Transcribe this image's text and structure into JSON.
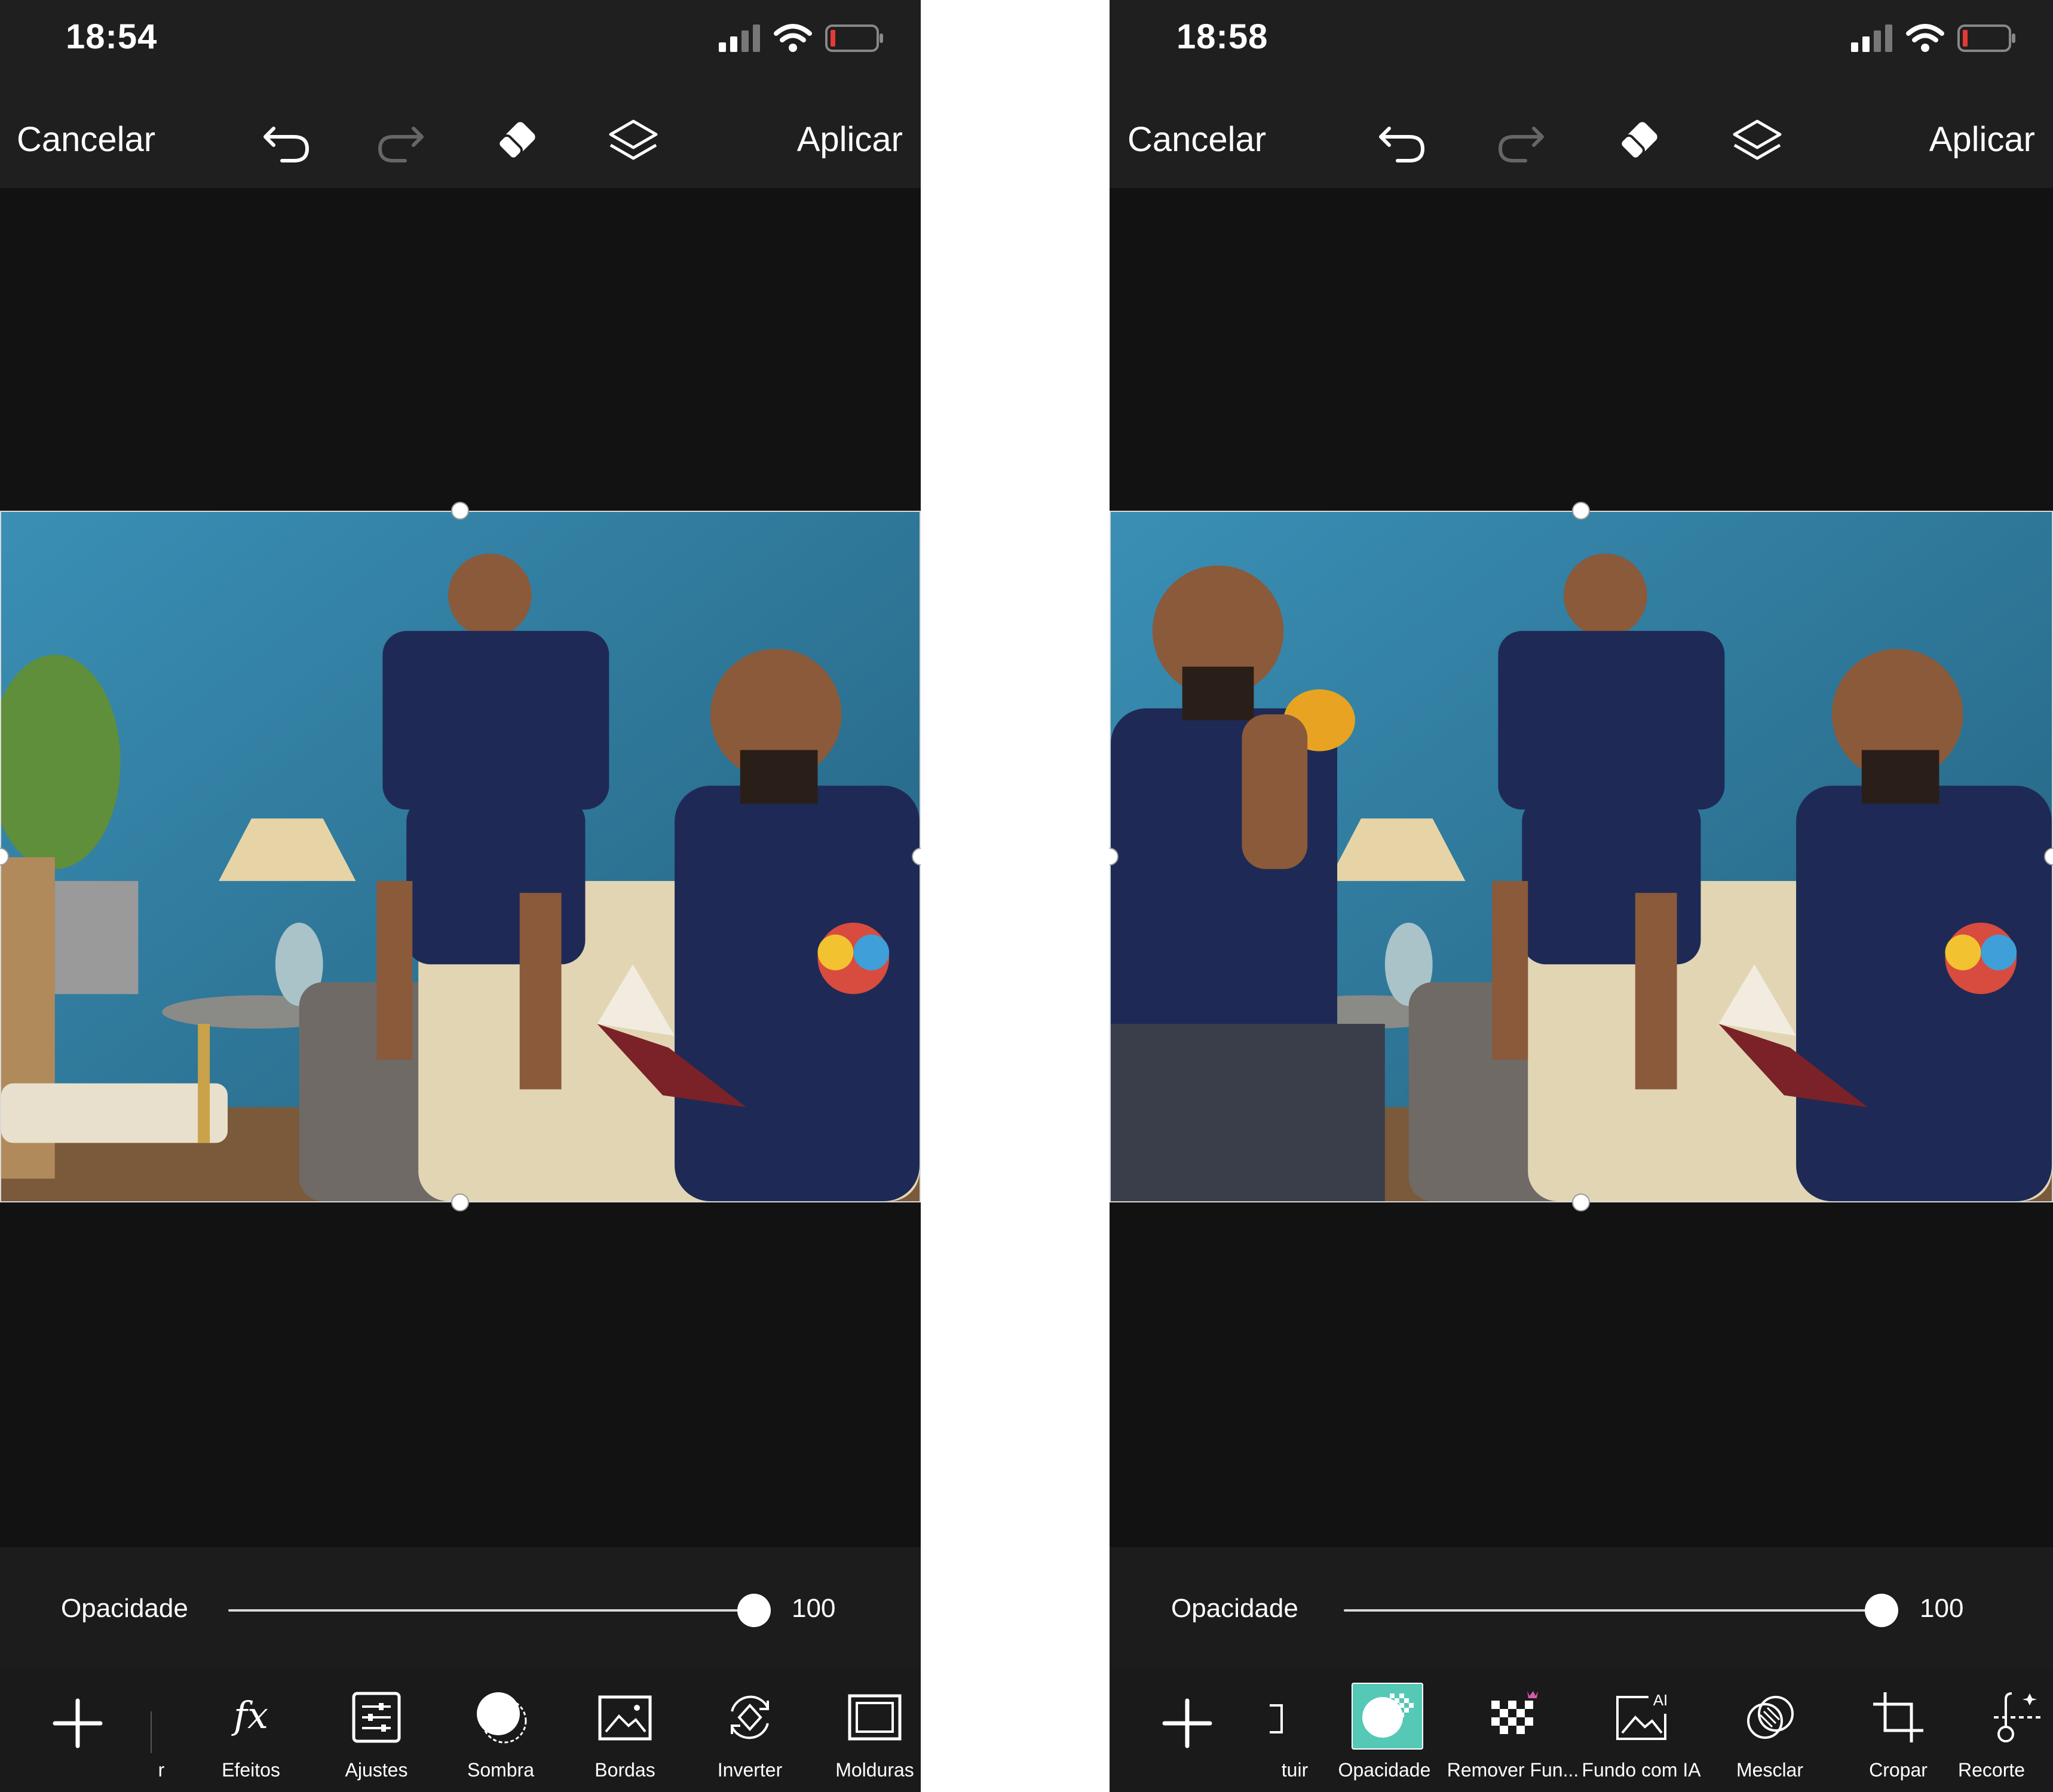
{
  "left_screen": {
    "status": {
      "time": "18:54"
    },
    "toolbar": {
      "cancel": "Cancelar",
      "apply": "Aplicar"
    },
    "opacity": {
      "label": "Opacidade",
      "value": "100",
      "level": 1.0
    },
    "tools": [
      {
        "label": "r",
        "icon": "partial-icon"
      },
      {
        "label": "Efeitos",
        "icon": "fx-icon"
      },
      {
        "label": "Ajustes",
        "icon": "adjust-icon"
      },
      {
        "label": "Sombra",
        "icon": "shadow-icon"
      },
      {
        "label": "Bordas",
        "icon": "border-icon"
      },
      {
        "label": "Inverter",
        "icon": "flip-icon"
      },
      {
        "label": "Molduras",
        "icon": "frame-icon"
      }
    ]
  },
  "right_screen": {
    "status": {
      "time": "18:58"
    },
    "toolbar": {
      "cancel": "Cancelar",
      "apply": "Aplicar"
    },
    "opacity": {
      "label": "Opacidade",
      "value": "100",
      "level": 1.0
    },
    "tools": [
      {
        "label": "tuir",
        "icon": "partial-icon"
      },
      {
        "label": "Opacidade",
        "icon": "opacity-icon",
        "active": true
      },
      {
        "label": "Remover Fun...",
        "icon": "remove-bg-icon"
      },
      {
        "label": "Fundo com IA",
        "icon": "ai-background-icon"
      },
      {
        "label": "Mesclar",
        "icon": "blend-icon"
      },
      {
        "label": "Cropar",
        "icon": "crop-icon"
      },
      {
        "label": "Recorte",
        "icon": "cutout-icon"
      }
    ]
  },
  "colors": {
    "accent": "#55c8b6",
    "background": "#121212",
    "toolbar": "#1f1f1f",
    "battery_low": "#e53935",
    "wall": "#2f7fa3"
  }
}
